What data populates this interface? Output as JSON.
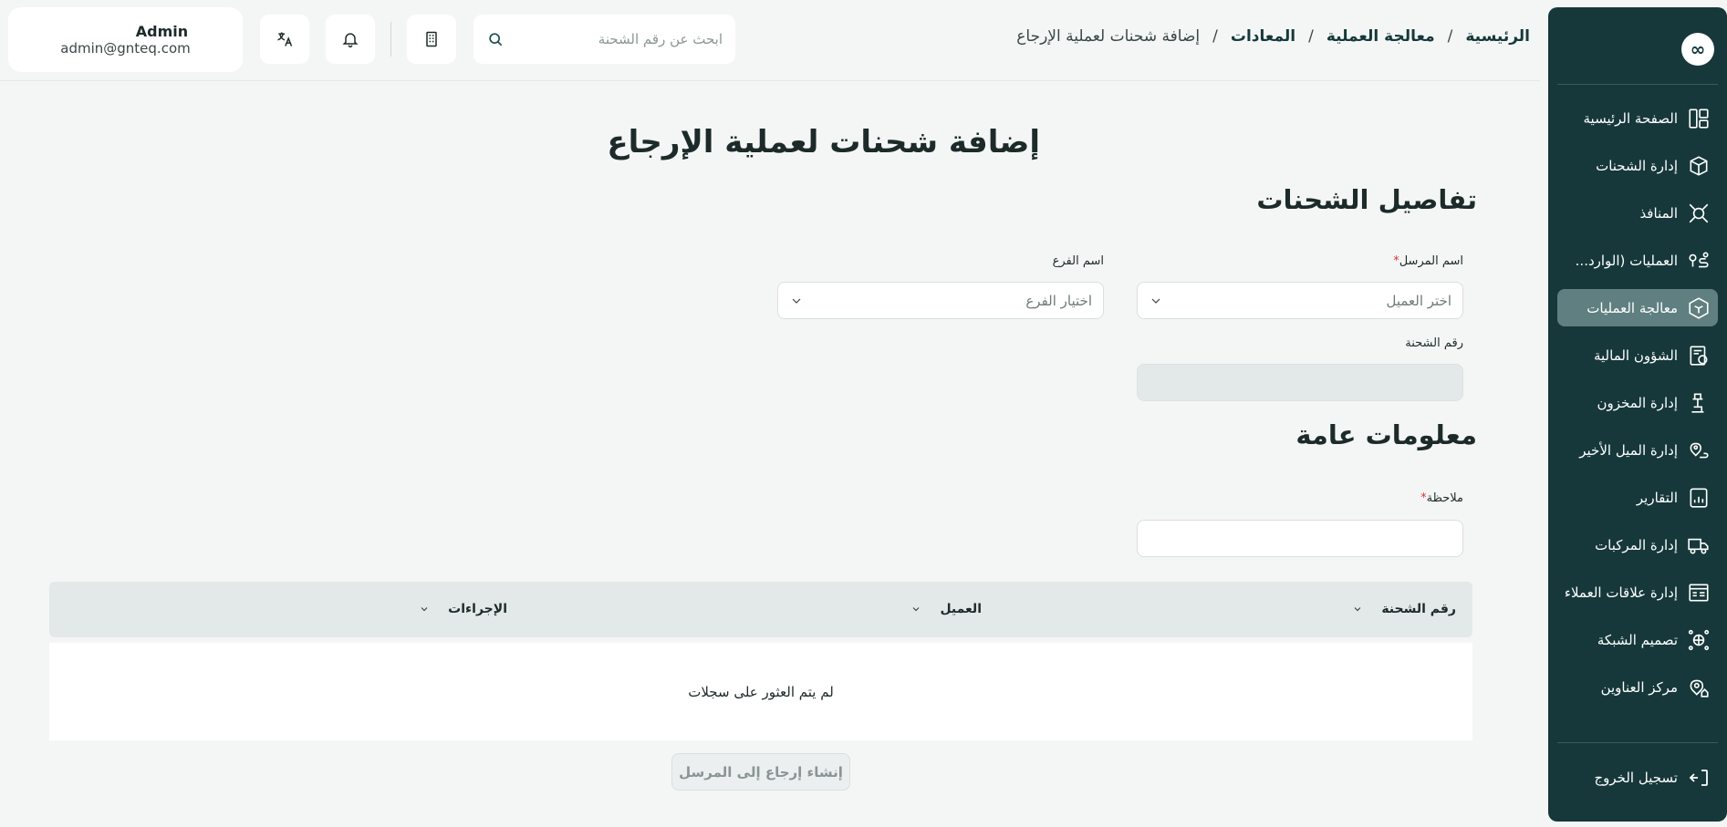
{
  "user": {
    "name": "Admin",
    "email": "admin@gnteq.com"
  },
  "search": {
    "placeholder": "ابحث عن رقم الشحنة"
  },
  "breadcrumb": {
    "items": [
      "الرئيسية",
      "معالجة العملية",
      "المعادات"
    ],
    "current": "إضافة شحنات لعملية الإرجاع",
    "separator": "/"
  },
  "sidebar": {
    "logo": "∞",
    "items": [
      {
        "label": "الصفحة الرئيسية",
        "icon": "dashboard-icon"
      },
      {
        "label": "إدارة الشحنات",
        "icon": "box-icon"
      },
      {
        "label": "المنافذ",
        "icon": "network-icon"
      },
      {
        "label": "العمليات (الوارد...",
        "icon": "route-icon"
      },
      {
        "label": "معالجة العمليات",
        "icon": "package-process-icon",
        "active": true
      },
      {
        "label": "الشؤون المالية",
        "icon": "finance-icon"
      },
      {
        "label": "إدارة المخزون",
        "icon": "inventory-icon"
      },
      {
        "label": "إدارة الميل الأخير",
        "icon": "last-mile-icon"
      },
      {
        "label": "التقارير",
        "icon": "reports-icon"
      },
      {
        "label": "إدارة المركبات",
        "icon": "truck-icon"
      },
      {
        "label": "إدارة علاقات العملاء",
        "icon": "crm-icon"
      },
      {
        "label": "تصميم الشبكة",
        "icon": "network-design-icon"
      },
      {
        "label": "مركز العناوين",
        "icon": "address-icon"
      }
    ],
    "logout": "تسجيل الخروج"
  },
  "page": {
    "title": "إضافة شحنات لعملية الإرجاع"
  },
  "shipment_details": {
    "title": "تفاصيل الشحنات",
    "sender_label": "اسم المرسل",
    "sender_placeholder": "اختر العميل",
    "branch_label": "اسم الفرع",
    "branch_placeholder": "اختيار الفرع",
    "shipment_number_label": "رقم الشحنة",
    "required_mark": "*"
  },
  "general_info": {
    "title": "معلومات عامة",
    "note_label": "ملاحظة"
  },
  "table": {
    "columns": [
      "رقم الشحنة",
      "العميل",
      "الإجراءات"
    ],
    "empty_message": "لم يتم العثور على سجلات"
  },
  "actions": {
    "submit_label": "إنشاء إرجاع إلى المرسل"
  }
}
